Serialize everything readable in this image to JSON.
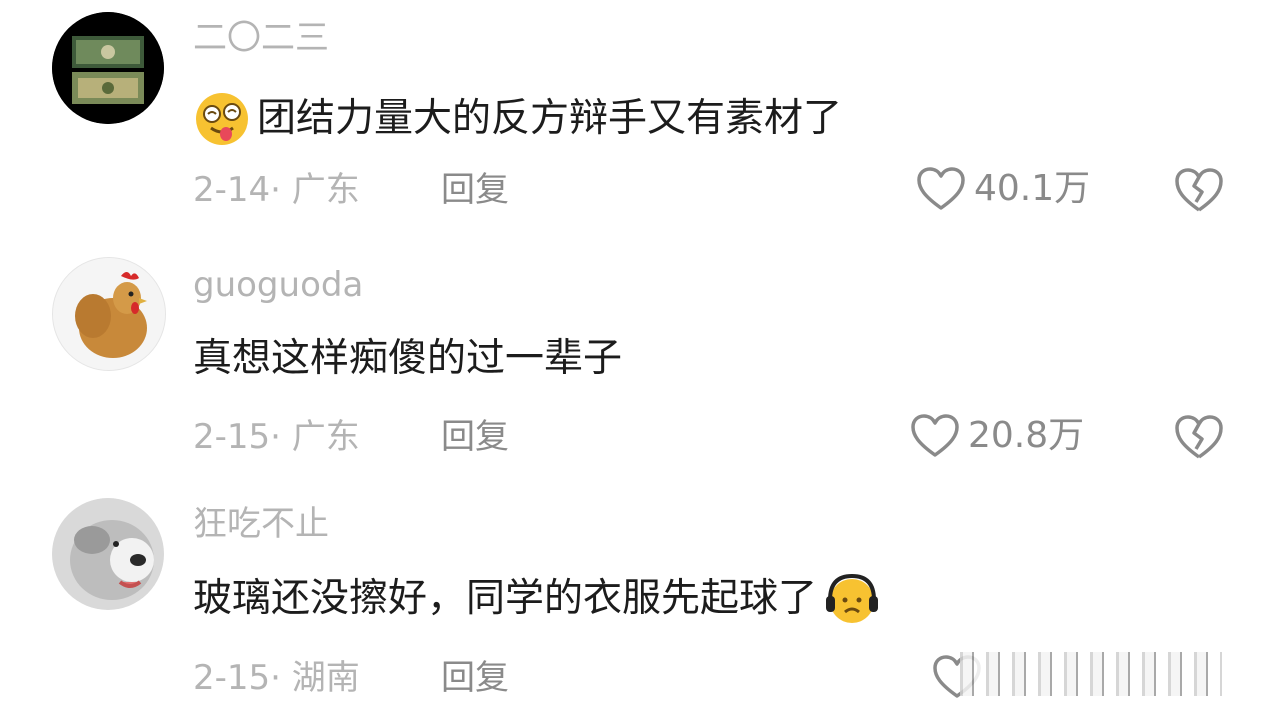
{
  "comments": [
    {
      "username": "二〇二三",
      "text": "团结力量大的反方辩手又有素材了",
      "date_location": "2-14· 广东",
      "reply_label": "回复",
      "likes": "40.1万",
      "avatar_icon": "banknote-avatar",
      "emoji_icon": "dizzy-tongue-emoji"
    },
    {
      "username": "guoguoda",
      "text": "真想这样痴傻的过一辈子",
      "date_location": "2-15· 广东",
      "reply_label": "回复",
      "likes": "20.8万",
      "avatar_icon": "chicken-avatar"
    },
    {
      "username": "狂吃不止",
      "text": "玻璃还没擦好，同学的衣服先起球了",
      "date_location": "2-15· 湖南",
      "reply_label": "回复",
      "avatar_icon": "otter-avatar",
      "emoji_icon": "headphones-sad-emoji"
    }
  ],
  "colors": {
    "secondary_text": "#b4b4b4",
    "action_text": "#8a8a8a",
    "primary_text": "#1c1c1c"
  }
}
